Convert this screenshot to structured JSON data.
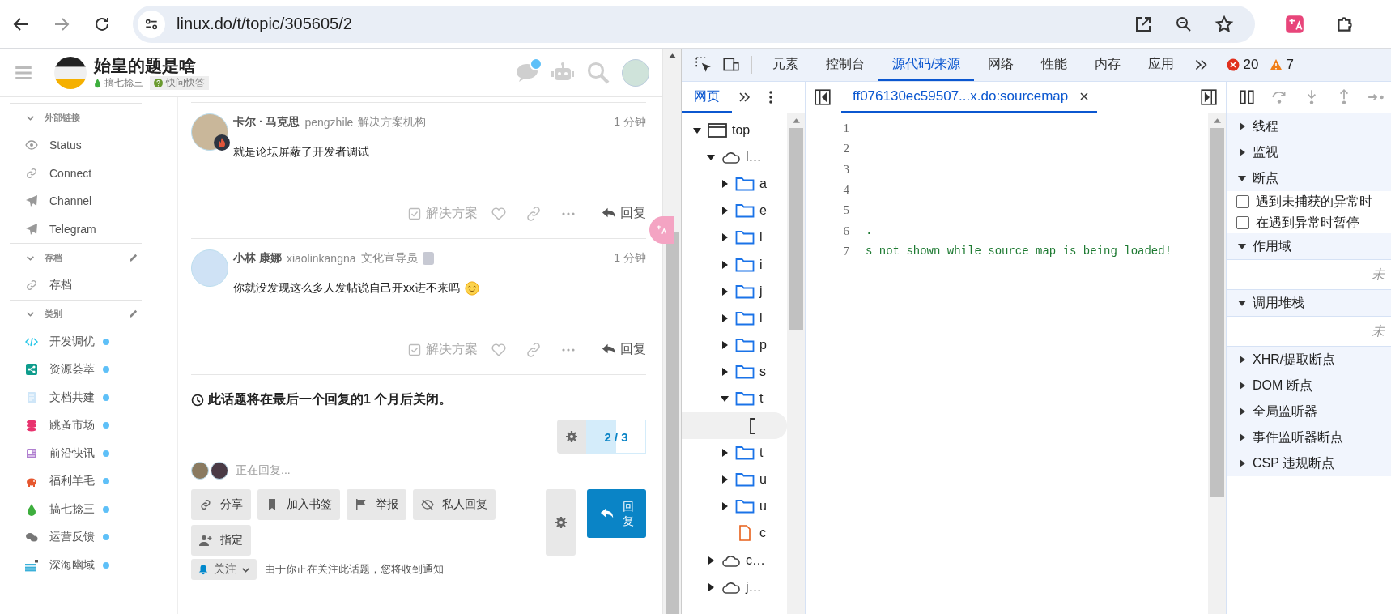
{
  "browser": {
    "url": "linux.do/t/topic/305605/2"
  },
  "header": {
    "title": "始皇的题是啥",
    "category": "搞七捻三",
    "tag": "快问快答",
    "chat_unread": true
  },
  "sidebar": {
    "sections": [
      {
        "title": "外部链接",
        "expanded": true,
        "items": [
          {
            "label": "Status",
            "kind": "eye"
          },
          {
            "label": "Connect",
            "kind": "link"
          },
          {
            "label": "Channel",
            "kind": "plane"
          },
          {
            "label": "Telegram",
            "kind": "plane"
          }
        ]
      },
      {
        "title": "存档",
        "expanded": true,
        "editable": true,
        "items": [
          {
            "label": "存档",
            "kind": "link"
          }
        ]
      },
      {
        "title": "类别",
        "expanded": true,
        "editable": true,
        "items": [
          {
            "label": "开发调优",
            "kind": "code",
            "color": "#25c6e8",
            "unread": true
          },
          {
            "label": "资源荟萃",
            "kind": "share",
            "color": "#0e9c8c",
            "unread": true
          },
          {
            "label": "文档共建",
            "kind": "doc",
            "color": "#cfe6f8",
            "unread": true
          },
          {
            "label": "跳蚤市场",
            "kind": "coins",
            "color": "#e8336e",
            "unread": true
          },
          {
            "label": "前沿快讯",
            "kind": "news",
            "color": "#b07fd0",
            "unread": true
          },
          {
            "label": "福利羊毛",
            "kind": "piggy",
            "color": "#e6572f",
            "unread": true
          },
          {
            "label": "搞七捻三",
            "kind": "drop",
            "color": "#3dae3d",
            "unread": true
          },
          {
            "label": "运营反馈",
            "kind": "chat",
            "color": "#777777",
            "unread": true
          },
          {
            "label": "深海幽域",
            "kind": "waves",
            "color": "#3ab0d9",
            "unread": true
          }
        ]
      }
    ]
  },
  "posts": [
    {
      "name": "卡尔 · 马克思",
      "username": "pengzhile",
      "title": "解决方案机构",
      "time": "1 分钟",
      "body": "就是论坛屏蔽了开发者调试",
      "avatar_badge": true,
      "solution": "解决方案",
      "reply": "回复"
    },
    {
      "name": "小林 康娜",
      "username": "xiaolinkangna",
      "title": "文化宣导员",
      "time": "1 分钟",
      "body": "你就没发现这么多人发帖说自己开xx进不来吗",
      "flair": true,
      "emoji": true,
      "solution": "解决方案",
      "reply": "回复"
    }
  ],
  "notice": "此话题将在最后一个回复的1 个月后关闭。",
  "progress": {
    "label": "2 / 3",
    "level": 0.5
  },
  "typing": "正在回复...",
  "actions": [
    {
      "label": "分享",
      "kind": "link"
    },
    {
      "label": "加入书签",
      "kind": "bookmark"
    },
    {
      "label": "举报",
      "kind": "flag"
    },
    {
      "label": "私人回复",
      "kind": "eye-off"
    },
    {
      "label": "指定",
      "kind": "user-plus"
    }
  ],
  "reply_button": "回复",
  "notification": {
    "level": "关注",
    "text": "由于你正在关注此话题，您将收到通知"
  },
  "devtools": {
    "tabs": [
      {
        "label": "元素",
        "selected": false
      },
      {
        "label": "控制台",
        "selected": false
      },
      {
        "label": "源代码/来源",
        "selected": true
      },
      {
        "label": "网络",
        "selected": false
      },
      {
        "label": "性能",
        "selected": false
      },
      {
        "label": "内存",
        "selected": false
      },
      {
        "label": "应用",
        "selected": false
      }
    ],
    "errors": "20",
    "warnings": "7",
    "navigator": {
      "tab": "网页",
      "tree": [
        {
          "label": "top",
          "kind": "frame",
          "expanded": true,
          "selected": false,
          "children": [
            {
              "label": "l…",
              "kind": "cloud",
              "expanded": true,
              "selected": false,
              "children": [
                {
                  "label": "a",
                  "kind": "folder",
                  "expanded": false,
                  "selected": false
                },
                {
                  "label": "e",
                  "kind": "folder",
                  "expanded": false,
                  "selected": false
                },
                {
                  "label": "l",
                  "kind": "folder",
                  "expanded": false,
                  "selected": false
                },
                {
                  "label": "i",
                  "kind": "folder",
                  "expanded": false,
                  "selected": false
                },
                {
                  "label": "j",
                  "kind": "folder",
                  "expanded": false,
                  "selected": false
                },
                {
                  "label": "l",
                  "kind": "folder",
                  "expanded": false,
                  "selected": false
                },
                {
                  "label": "p",
                  "kind": "folder",
                  "expanded": false,
                  "selected": false
                },
                {
                  "label": "s",
                  "kind": "folder",
                  "expanded": false,
                  "selected": false
                },
                {
                  "label": "t",
                  "kind": "folder",
                  "expanded": true,
                  "selected": false,
                  "children": [
                    {
                      "kind": "document",
                      "selected": true
                    }
                  ]
                },
                {
                  "label": "t",
                  "kind": "folder",
                  "expanded": false,
                  "selected": false
                },
                {
                  "label": "u",
                  "kind": "folder",
                  "expanded": false,
                  "selected": false
                },
                {
                  "label": "u",
                  "kind": "folder",
                  "expanded": false,
                  "selected": false
                },
                {
                  "label": "c",
                  "kind": "file",
                  "selected": false
                }
              ]
            },
            {
              "label": "c…",
              "kind": "cloud",
              "expanded": false,
              "selected": false
            },
            {
              "label": "j…",
              "kind": "cloud",
              "expanded": false,
              "selected": false
            }
          ]
        }
      ]
    },
    "editor": {
      "file_tab": "ff076130ec59507...x.do:sourcemap",
      "lines": [
        {
          "number": "1"
        },
        {
          "number": "2"
        },
        {
          "number": "3"
        },
        {
          "number": "4"
        },
        {
          "number": "5"
        },
        {
          "number": "6",
          "text": "."
        },
        {
          "number": "7",
          "text": "s not shown while source map is being loaded!"
        }
      ]
    },
    "debugger": {
      "sections": [
        {
          "label": "线程",
          "expanded": false
        },
        {
          "label": "监视",
          "expanded": false
        },
        {
          "label": "断点",
          "expanded": true,
          "checkboxes": [
            {
              "label": "遇到未捕获的异常时",
              "checked": false
            },
            {
              "label": "在遇到异常时暂停",
              "checked": false
            }
          ]
        },
        {
          "label": "作用域",
          "expanded": true,
          "empty_text": "未"
        },
        {
          "label": "调用堆栈",
          "expanded": true,
          "empty_text": "未"
        },
        {
          "label": "XHR/提取断点",
          "expanded": false
        },
        {
          "label": "DOM 断点",
          "expanded": false
        },
        {
          "label": "全局监听器",
          "expanded": false
        },
        {
          "label": "事件监听器断点",
          "expanded": false
        },
        {
          "label": "CSP 违规断点",
          "expanded": false
        }
      ]
    }
  }
}
